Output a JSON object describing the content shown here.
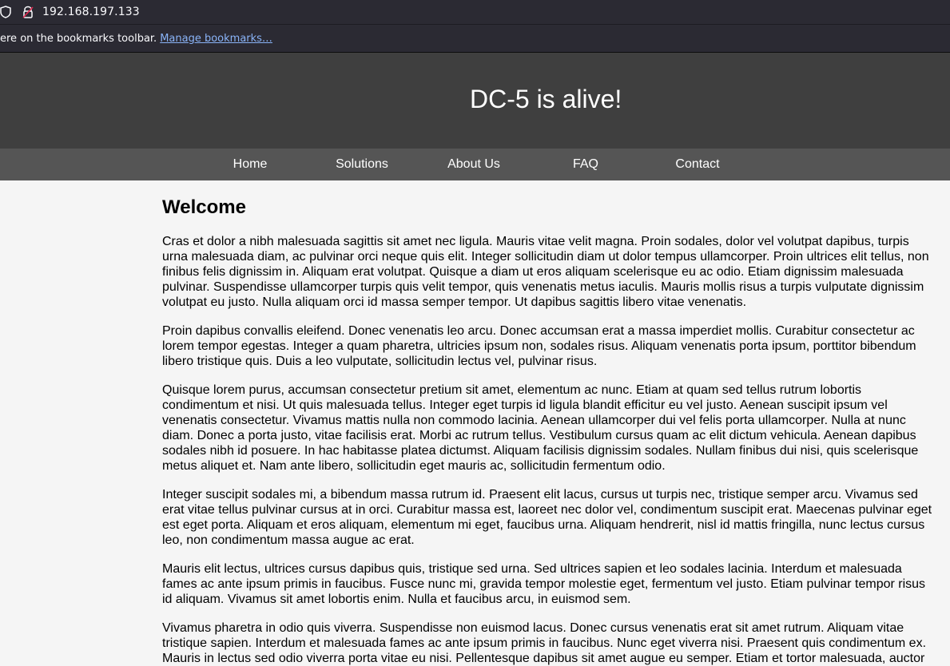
{
  "browser": {
    "url": "192.168.197.133",
    "bookmarks_message": "ere on the bookmarks toolbar.",
    "bookmarks_link": "Manage bookmarks…"
  },
  "site": {
    "title": "DC-5 is alive!"
  },
  "nav": {
    "items": [
      "Home",
      "Solutions",
      "About Us",
      "FAQ",
      "Contact"
    ]
  },
  "main": {
    "heading": "Welcome",
    "paragraphs": [
      "Cras et dolor a nibh malesuada sagittis sit amet nec ligula. Mauris vitae velit magna. Proin sodales, dolor vel volutpat dapibus, turpis urna malesuada diam, ac pulvinar orci neque quis elit. Integer sollicitudin diam ut dolor tempus ullamcorper. Proin ultrices elit tellus, non finibus felis dignissim in. Aliquam erat volutpat. Quisque a diam ut eros aliquam scelerisque eu ac odio. Etiam dignissim malesuada pulvinar. Suspendisse ullamcorper turpis quis velit tempor, quis venenatis metus iaculis. Mauris mollis risus a turpis vulputate dignissim volutpat eu justo. Nulla aliquam orci id massa semper tempor. Ut dapibus sagittis libero vitae venenatis.",
      "Proin dapibus convallis eleifend. Donec venenatis leo arcu. Donec accumsan erat a massa imperdiet mollis. Curabitur consectetur ac lorem tempor egestas. Integer a quam pharetra, ultricies ipsum non, sodales risus. Aliquam venenatis porta ipsum, porttitor bibendum libero tristique quis. Duis a leo vulputate, sollicitudin lectus vel, pulvinar risus.",
      "Quisque lorem purus, accumsan consectetur pretium sit amet, elementum ac nunc. Etiam at quam sed tellus rutrum lobortis condimentum et nisi. Ut quis malesuada tellus. Integer eget turpis id ligula blandit efficitur eu vel justo. Aenean suscipit ipsum vel venenatis consectetur. Vivamus mattis nulla non commodo lacinia. Aenean ullamcorper dui vel felis porta ullamcorper. Nulla at nunc diam. Donec a porta justo, vitae facilisis erat. Morbi ac rutrum tellus. Vestibulum cursus quam ac elit dictum vehicula. Aenean dapibus sodales nibh id posuere. In hac habitasse platea dictumst. Aliquam facilisis dignissim sodales. Nullam finibus dui nisi, quis scelerisque metus aliquet et. Nam ante libero, sollicitudin eget mauris ac, sollicitudin fermentum odio.",
      "Integer suscipit sodales mi, a bibendum massa rutrum id. Praesent elit lacus, cursus ut turpis nec, tristique semper arcu. Vivamus sed erat vitae tellus pulvinar cursus at in orci. Curabitur massa est, laoreet nec dolor vel, condimentum suscipit erat. Maecenas pulvinar eget est eget porta. Aliquam et eros aliquam, elementum mi eget, faucibus urna. Aliquam hendrerit, nisl id mattis fringilla, nunc lectus cursus leo, non condimentum massa augue ac erat.",
      "Mauris elit lectus, ultrices cursus dapibus quis, tristique sed urna. Sed ultrices sapien et leo sodales lacinia. Interdum et malesuada fames ac ante ipsum primis in faucibus. Fusce nunc mi, gravida tempor molestie eget, fermentum vel justo. Etiam pulvinar tempor risus id aliquam. Vivamus sit amet lobortis enim. Nulla et faucibus arcu, in euismod sem.",
      "Vivamus pharetra in odio quis viverra. Suspendisse non euismod lacus. Donec cursus venenatis erat sit amet rutrum. Aliquam vitae tristique sapien. Interdum et malesuada fames ac ante ipsum primis in faucibus. Nunc eget viverra nisi. Praesent quis condimentum ex. Mauris in lectus sed odio viverra porta vitae eu nisi. Pellentesque dapibus sit amet augue eu semper. Etiam et tortor malesuada, auctor"
    ]
  },
  "icons": {
    "shield": "shield-icon",
    "lock": "insecure-lock-icon"
  },
  "colors": {
    "browser_chrome": "#2b2a33",
    "header_bg": "#3f3f3f",
    "nav_bg": "#555555",
    "page_bg": "#f5f5f5",
    "link": "#8ab4f8",
    "lock_warning": "#e22850"
  }
}
